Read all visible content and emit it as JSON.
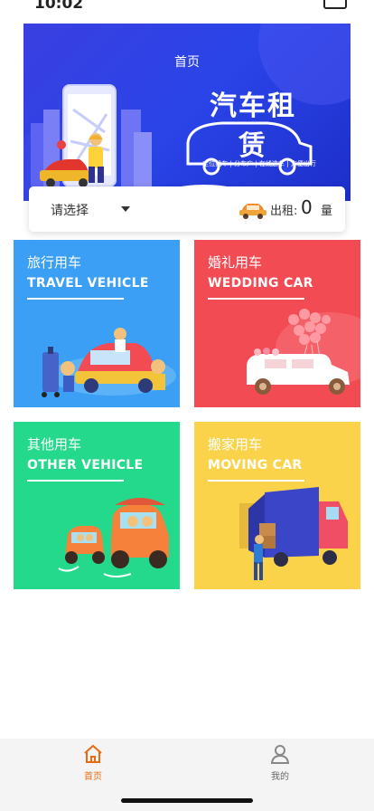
{
  "status_bar": {
    "time": "10:02"
  },
  "banner": {
    "title": "首页",
    "logo_text": "汽车租赁",
    "tagline": "定位找车 | 分布广 | 在线选车 | 方便出行"
  },
  "filter": {
    "select_placeholder": "请选择",
    "rent_label": "出租:",
    "rent_count": "0",
    "rent_unit": "量"
  },
  "categories": [
    {
      "title_cn": "旅行用车",
      "title_en": "TRAVEL VEHICLE",
      "color": "#3a9ff5"
    },
    {
      "title_cn": "婚礼用车",
      "title_en": "WEDDING CAR",
      "color": "#f24b54"
    },
    {
      "title_cn": "其他用车",
      "title_en": "OTHER VEHICLE",
      "color": "#25d98c"
    },
    {
      "title_cn": "搬家用车",
      "title_en": "MOVING CAR",
      "color": "#fbd34a"
    }
  ],
  "tabbar": {
    "home_label": "首页",
    "mine_label": "我的",
    "active_color": "#e96b10"
  }
}
